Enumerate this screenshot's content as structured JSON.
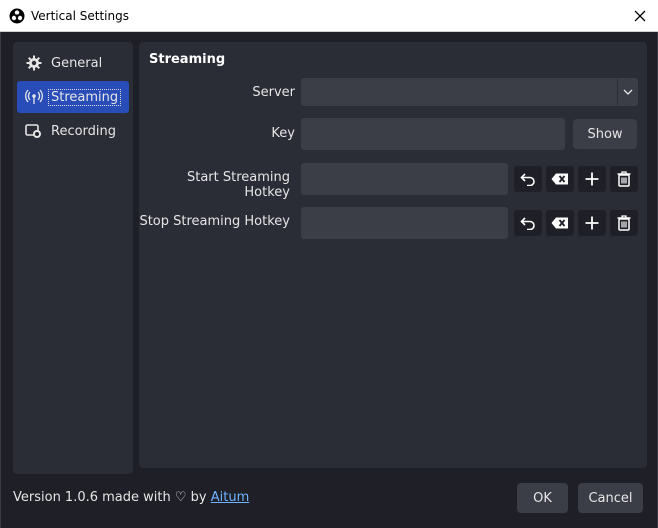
{
  "window": {
    "title": "Vertical Settings",
    "icon": "obs-icon",
    "close_icon": "close-icon"
  },
  "sidebar": {
    "items": [
      {
        "label": "General",
        "icon": "gear-icon",
        "active": false
      },
      {
        "label": "Streaming",
        "icon": "broadcast-antenna-icon",
        "active": true
      },
      {
        "label": "Recording",
        "icon": "record-camera-icon",
        "active": false
      }
    ]
  },
  "streaming": {
    "title": "Streaming",
    "server_label": "Server",
    "server_value": "",
    "key_label": "Key",
    "key_value": "",
    "show_button": "Show",
    "start_hotkey_label": "Start Streaming Hotkey",
    "start_hotkey_value": "",
    "stop_hotkey_label": "Stop Streaming Hotkey",
    "stop_hotkey_value": "",
    "hotkey_buttons": [
      "undo-icon",
      "clear-icon",
      "add-icon",
      "trash-icon"
    ]
  },
  "footer": {
    "version_text": "Version 1.0.6 made with ♡ by ",
    "link_text": "Aitum",
    "ok_button": "OK",
    "cancel_button": "Cancel"
  },
  "colors": {
    "background": "#1e1f27",
    "panel": "#2a2c36",
    "field": "#3b3d47",
    "accent": "#284cb8",
    "link": "#6fb3ff"
  }
}
